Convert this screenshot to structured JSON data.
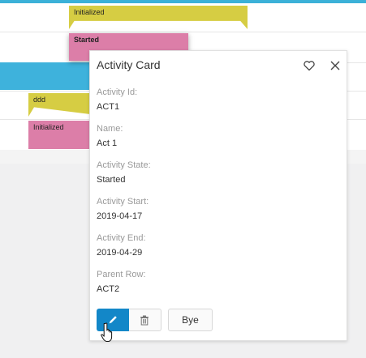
{
  "gantt": {
    "bars": [
      {
        "label": "Initialized",
        "color": "#d6cd43"
      },
      {
        "label": "Started",
        "color": "#dc7ea8"
      },
      {
        "label": "ddd",
        "color": "#d6cd43"
      },
      {
        "label": "Initialized",
        "color": "#dc7ea8"
      }
    ],
    "accent": "#3bb1d8"
  },
  "card": {
    "title": "Activity Card",
    "icons": {
      "favorite": "heart-icon",
      "close": "close-icon"
    },
    "fields": [
      {
        "label": "Activity Id:",
        "value": "ACT1"
      },
      {
        "label": "Name:",
        "value": "Act 1"
      },
      {
        "label": "Activity State:",
        "value": "Started"
      },
      {
        "label": "Activity Start:",
        "value": "2019-04-17"
      },
      {
        "label": "Activity End:",
        "value": "2019-04-29"
      },
      {
        "label": "Parent Row:",
        "value": "ACT2"
      }
    ],
    "buttons": {
      "edit_icon": "pencil-icon",
      "delete_icon": "trash-icon",
      "bye_label": "Bye"
    },
    "primary_color": "#1387c8"
  }
}
